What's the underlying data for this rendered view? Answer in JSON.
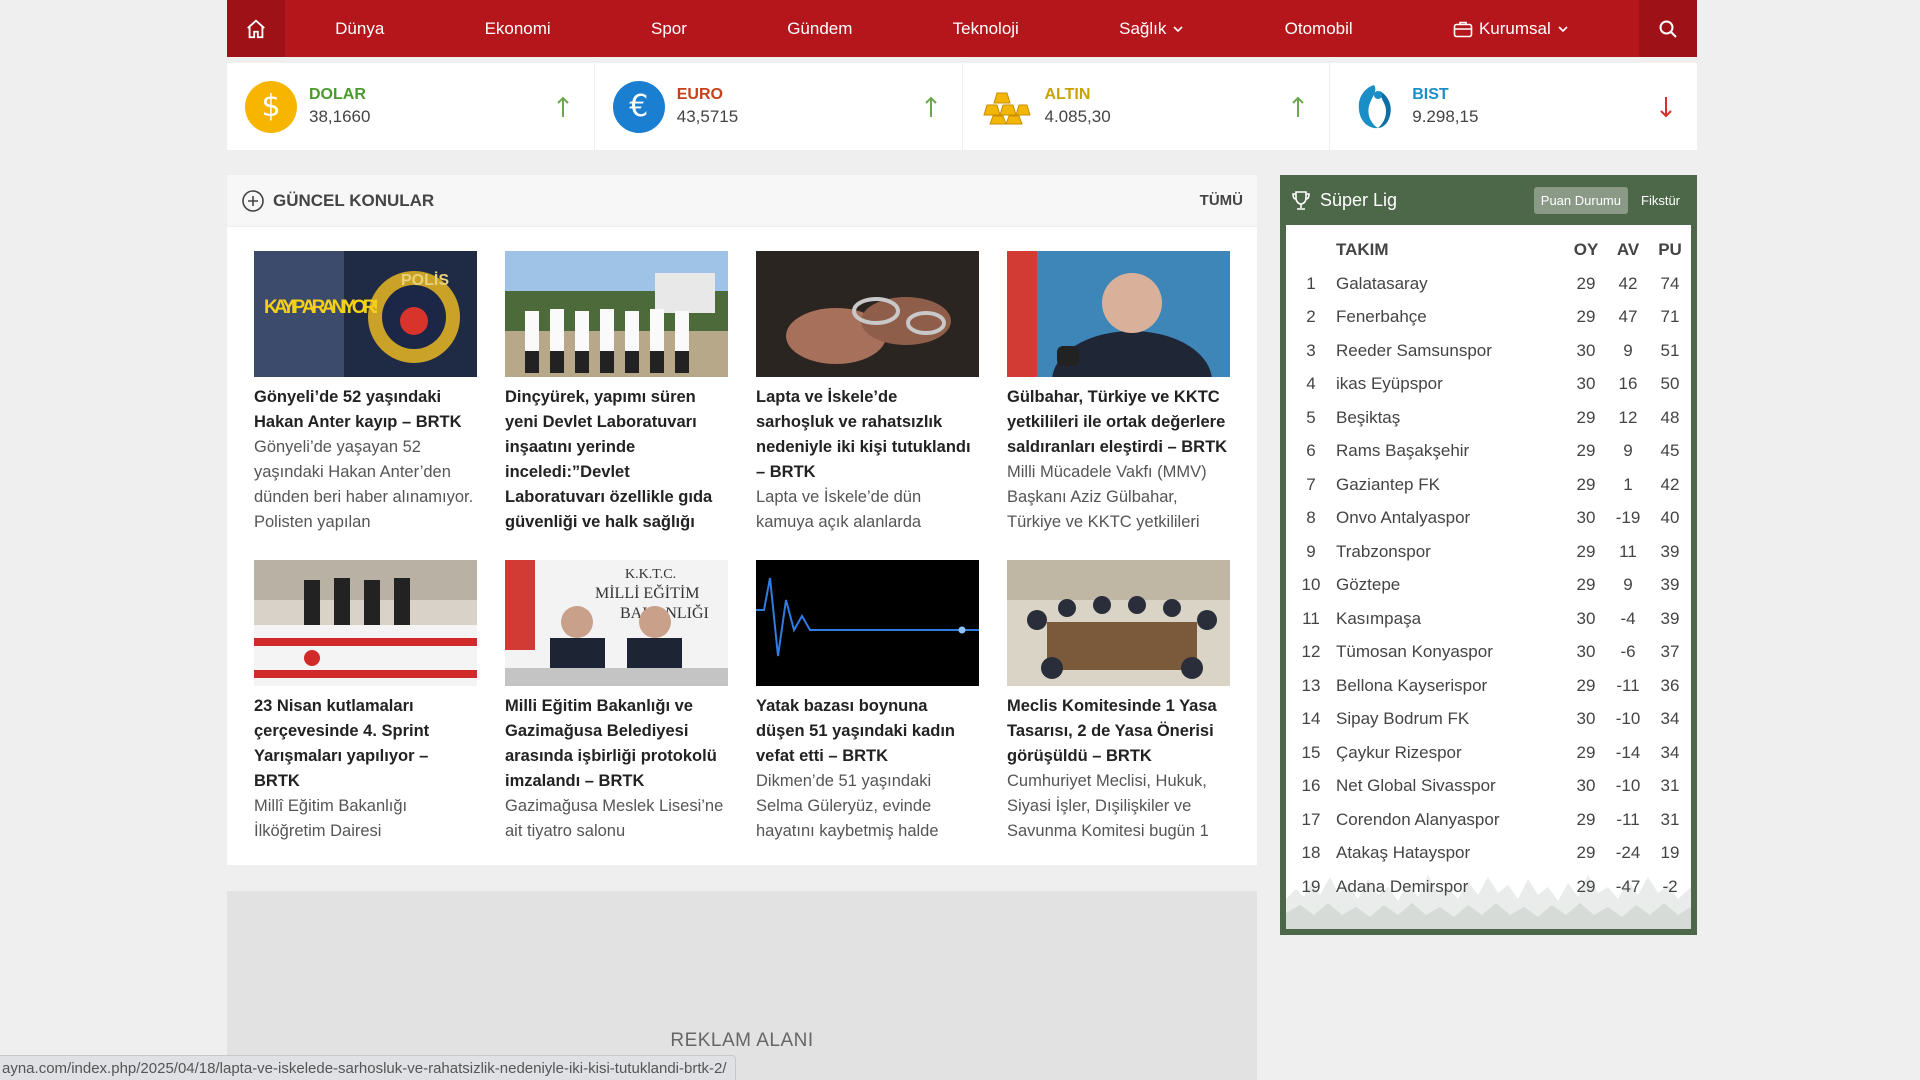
{
  "nav": {
    "items": [
      {
        "label": "Dünya",
        "dropdown": false
      },
      {
        "label": "Ekonomi",
        "dropdown": false
      },
      {
        "label": "Spor",
        "dropdown": false
      },
      {
        "label": "Gündem",
        "dropdown": false
      },
      {
        "label": "Teknoloji",
        "dropdown": false
      },
      {
        "label": "Sağlık",
        "dropdown": true
      },
      {
        "label": "Otomobil",
        "dropdown": false
      },
      {
        "label": "Kurumsal",
        "dropdown": true
      }
    ]
  },
  "tickers": [
    {
      "name": "DOLAR",
      "value": "38,1660",
      "trend": "up",
      "color": "#4a9a2e",
      "icon": "dollar-icon"
    },
    {
      "name": "EURO",
      "value": "43,5715",
      "trend": "up",
      "color": "#c8401a",
      "icon": "euro-icon"
    },
    {
      "name": "ALTIN",
      "value": "4.085,30",
      "trend": "up",
      "color": "#c9a400",
      "icon": "gold-bars-icon"
    },
    {
      "name": "BIST",
      "value": "9.298,15",
      "trend": "down",
      "color": "#1a8ec7",
      "icon": "bist-logo-icon"
    }
  ],
  "news": {
    "header": "GÜNCEL KONULAR",
    "all_label": "TÜMÜ",
    "thumb_texts": {
      "kayip": "KAYIP ARANIYOR!",
      "polis": "POLİS",
      "kktc": "K.K.T.C.",
      "milli": "MİLLİ EĞİTİM",
      "bakanligi": "BAKANLIĞI"
    },
    "items": [
      {
        "title": "Gönyeli’de 52 yaşındaki Hakan Anter kayıp – BRTK",
        "desc": "Gönyeli’de yaşayan 52 yaşındaki Hakan Anter’den dünden beri haber alınamıyor. Polisten yapılan"
      },
      {
        "title": "Dinçyürek, yapımı süren yeni Devlet Laboratuvarı inşaatını yerinde inceledi:”Devlet Laboratuvarı özellikle gıda güvenliği ve halk sağlığı",
        "desc": ""
      },
      {
        "title": "Lapta ve İskele’de sarhoşluk ve rahatsızlık nedeniyle iki kişi tutuklandı – BRTK",
        "desc": "Lapta ve İskele’de dün kamuya açık alanlarda"
      },
      {
        "title": "Gülbahar, Türkiye ve KKTC yetkilileri ile ortak değerlere saldıranları eleştirdi – BRTK",
        "desc": "Milli Mücadele Vakfı (MMV) Başkanı Aziz Gülbahar, Türkiye ve KKTC yetkilileri"
      },
      {
        "title": "23 Nisan kutlamaları çerçevesinde 4. Sprint Yarışmaları yapılıyor – BRTK",
        "desc": "Millî Eğitim Bakanlığı İlköğretim Dairesi"
      },
      {
        "title": "Milli Eğitim Bakanlığı ve Gazimağusa Belediyesi arasında işbirliği protokolü imzalandı – BRTK",
        "desc": "Gazimağusa Meslek Lisesi’ne ait tiyatro salonu"
      },
      {
        "title": "Yatak bazası boynuna düşen 51 yaşındaki kadın vefat etti – BRTK",
        "desc": "Dikmen’de 51 yaşındaki Selma Güleryüz, evinde hayatını kaybetmiş halde"
      },
      {
        "title": "Meclis Komitesinde 1 Yasa Tasarısı, 2 de Yasa Önerisi görüşüldü – BRTK",
        "desc": "Cumhuriyet Meclisi, Hukuk, Siyasi İşler, Dışilişkiler ve Savunma Komitesi bugün 1"
      }
    ]
  },
  "ad": {
    "label": "REKLAM ALANI"
  },
  "league": {
    "title": "Süper Lig",
    "tabs": [
      {
        "label": "Puan Durumu",
        "active": true
      },
      {
        "label": "Fikstür",
        "active": false
      }
    ],
    "columns": {
      "team": "TAKIM",
      "played": "OY",
      "avg": "AV",
      "points": "PU"
    },
    "rows": [
      {
        "pos": "1",
        "team": "Galatasaray",
        "oy": "29",
        "av": "42",
        "pu": "74"
      },
      {
        "pos": "2",
        "team": "Fenerbahçe",
        "oy": "29",
        "av": "47",
        "pu": "71"
      },
      {
        "pos": "3",
        "team": "Reeder Samsunspor",
        "oy": "30",
        "av": "9",
        "pu": "51"
      },
      {
        "pos": "4",
        "team": "ikas Eyüpspor",
        "oy": "30",
        "av": "16",
        "pu": "50"
      },
      {
        "pos": "5",
        "team": "Beşiktaş",
        "oy": "29",
        "av": "12",
        "pu": "48"
      },
      {
        "pos": "6",
        "team": "Rams Başakşehir",
        "oy": "29",
        "av": "9",
        "pu": "45"
      },
      {
        "pos": "7",
        "team": "Gaziantep FK",
        "oy": "29",
        "av": "1",
        "pu": "42"
      },
      {
        "pos": "8",
        "team": "Onvo Antalyaspor",
        "oy": "30",
        "av": "-19",
        "pu": "40"
      },
      {
        "pos": "9",
        "team": "Trabzonspor",
        "oy": "29",
        "av": "11",
        "pu": "39"
      },
      {
        "pos": "10",
        "team": "Göztepe",
        "oy": "29",
        "av": "9",
        "pu": "39"
      },
      {
        "pos": "11",
        "team": "Kasımpaşa",
        "oy": "30",
        "av": "-4",
        "pu": "39"
      },
      {
        "pos": "12",
        "team": "Tümosan Konyaspor",
        "oy": "30",
        "av": "-6",
        "pu": "37"
      },
      {
        "pos": "13",
        "team": "Bellona Kayserispor",
        "oy": "29",
        "av": "-11",
        "pu": "36"
      },
      {
        "pos": "14",
        "team": "Sipay Bodrum FK",
        "oy": "30",
        "av": "-10",
        "pu": "34"
      },
      {
        "pos": "15",
        "team": "Çaykur Rizespor",
        "oy": "29",
        "av": "-14",
        "pu": "34"
      },
      {
        "pos": "16",
        "team": "Net Global Sivasspor",
        "oy": "30",
        "av": "-10",
        "pu": "31"
      },
      {
        "pos": "17",
        "team": "Corendon Alanyaspor",
        "oy": "29",
        "av": "-11",
        "pu": "31"
      },
      {
        "pos": "18",
        "team": "Atakaş Hatayspor",
        "oy": "29",
        "av": "-24",
        "pu": "19"
      },
      {
        "pos": "19",
        "team": "Adana Demirspor",
        "oy": "29",
        "av": "-47",
        "pu": "-2"
      }
    ]
  },
  "statusbar": {
    "url": "ayna.com/index.php/2025/04/18/lapta-ve-iskelede-sarhosluk-ve-rahatsizlik-nedeniyle-iki-kisi-tutuklandi-brtk-2/"
  }
}
